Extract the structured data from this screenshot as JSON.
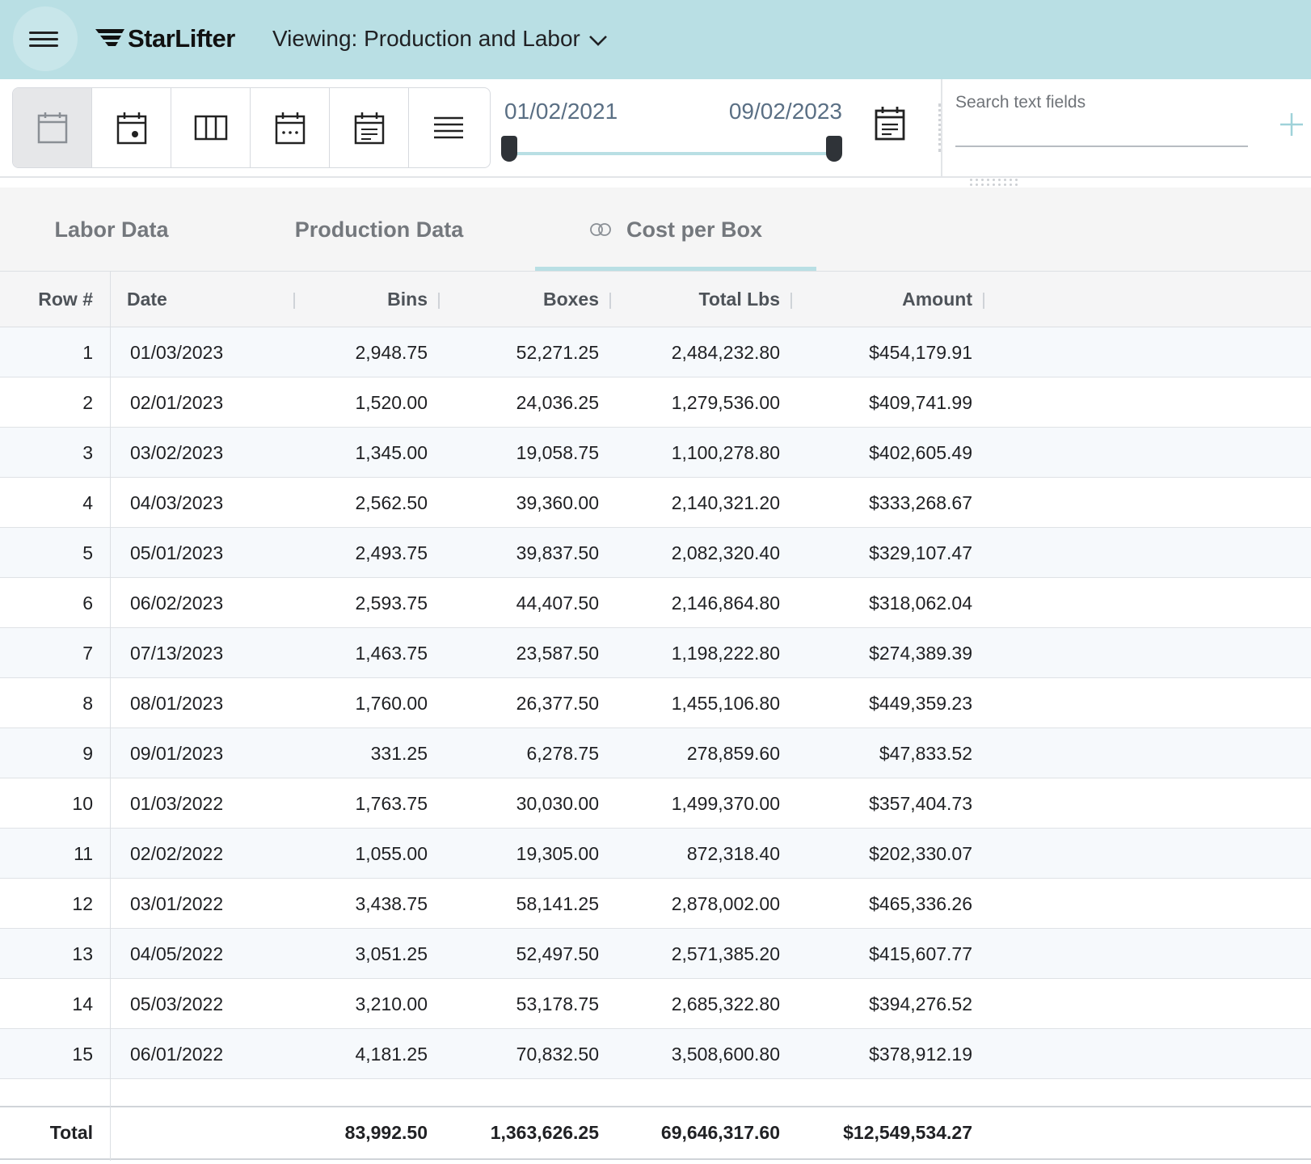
{
  "header": {
    "brand": "StarLifter",
    "viewing_label": "Viewing: Production and Labor"
  },
  "toolbar": {
    "view_buttons": [
      {
        "icon": "calendar-blank-icon",
        "active": true
      },
      {
        "icon": "calendar-day-icon",
        "active": false
      },
      {
        "icon": "columns-icon",
        "active": false
      },
      {
        "icon": "calendar-month-icon",
        "active": false
      },
      {
        "icon": "calendar-list-icon",
        "active": false
      },
      {
        "icon": "list-lines-icon",
        "active": false
      }
    ],
    "date_start": "01/02/2021",
    "date_end": "09/02/2023",
    "search_placeholder": "Search text fields"
  },
  "tabs": [
    {
      "label": "Labor Data",
      "active": false
    },
    {
      "label": "Production Data",
      "active": false
    },
    {
      "label": "Cost per Box",
      "active": true
    }
  ],
  "table": {
    "columns": [
      "Row #",
      "Date",
      "Bins",
      "Boxes",
      "Total Lbs",
      "Amount"
    ],
    "rows": [
      {
        "row": "1",
        "date": "01/03/2023",
        "bins": "2,948.75",
        "boxes": "52,271.25",
        "lbs": "2,484,232.80",
        "amount": "$454,179.91"
      },
      {
        "row": "2",
        "date": "02/01/2023",
        "bins": "1,520.00",
        "boxes": "24,036.25",
        "lbs": "1,279,536.00",
        "amount": "$409,741.99"
      },
      {
        "row": "3",
        "date": "03/02/2023",
        "bins": "1,345.00",
        "boxes": "19,058.75",
        "lbs": "1,100,278.80",
        "amount": "$402,605.49"
      },
      {
        "row": "4",
        "date": "04/03/2023",
        "bins": "2,562.50",
        "boxes": "39,360.00",
        "lbs": "2,140,321.20",
        "amount": "$333,268.67"
      },
      {
        "row": "5",
        "date": "05/01/2023",
        "bins": "2,493.75",
        "boxes": "39,837.50",
        "lbs": "2,082,320.40",
        "amount": "$329,107.47"
      },
      {
        "row": "6",
        "date": "06/02/2023",
        "bins": "2,593.75",
        "boxes": "44,407.50",
        "lbs": "2,146,864.80",
        "amount": "$318,062.04"
      },
      {
        "row": "7",
        "date": "07/13/2023",
        "bins": "1,463.75",
        "boxes": "23,587.50",
        "lbs": "1,198,222.80",
        "amount": "$274,389.39"
      },
      {
        "row": "8",
        "date": "08/01/2023",
        "bins": "1,760.00",
        "boxes": "26,377.50",
        "lbs": "1,455,106.80",
        "amount": "$449,359.23"
      },
      {
        "row": "9",
        "date": "09/01/2023",
        "bins": "331.25",
        "boxes": "6,278.75",
        "lbs": "278,859.60",
        "amount": "$47,833.52"
      },
      {
        "row": "10",
        "date": "01/03/2022",
        "bins": "1,763.75",
        "boxes": "30,030.00",
        "lbs": "1,499,370.00",
        "amount": "$357,404.73"
      },
      {
        "row": "11",
        "date": "02/02/2022",
        "bins": "1,055.00",
        "boxes": "19,305.00",
        "lbs": "872,318.40",
        "amount": "$202,330.07"
      },
      {
        "row": "12",
        "date": "03/01/2022",
        "bins": "3,438.75",
        "boxes": "58,141.25",
        "lbs": "2,878,002.00",
        "amount": "$465,336.26"
      },
      {
        "row": "13",
        "date": "04/05/2022",
        "bins": "3,051.25",
        "boxes": "52,497.50",
        "lbs": "2,571,385.20",
        "amount": "$415,607.77"
      },
      {
        "row": "14",
        "date": "05/03/2022",
        "bins": "3,210.00",
        "boxes": "53,178.75",
        "lbs": "2,685,322.80",
        "amount": "$394,276.52"
      },
      {
        "row": "15",
        "date": "06/01/2022",
        "bins": "4,181.25",
        "boxes": "70,832.50",
        "lbs": "3,508,600.80",
        "amount": "$378,912.19"
      }
    ],
    "totals": {
      "label": "Total",
      "bins": "83,992.50",
      "boxes": "1,363,626.25",
      "lbs": "69,646,317.60",
      "amount": "$12,549,534.27"
    }
  },
  "colors": {
    "header_bg": "#b9dfe4",
    "accent": "#b9dfe4"
  }
}
